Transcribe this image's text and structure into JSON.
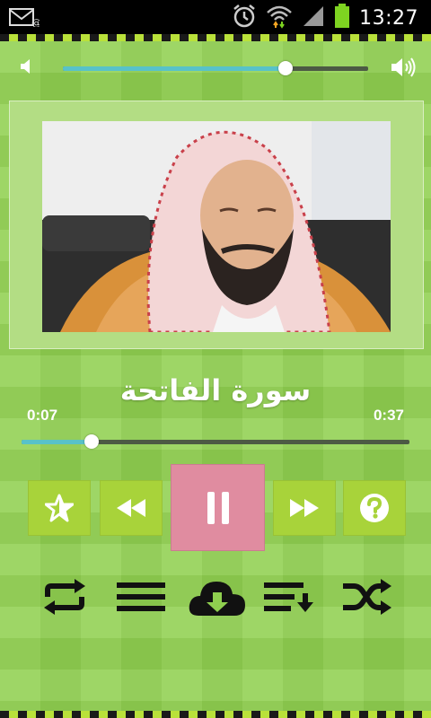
{
  "status_bar": {
    "time": "13:27",
    "icons": [
      "email-icon",
      "alarm-icon",
      "wifi-icon",
      "signal-icon",
      "battery-icon"
    ]
  },
  "player": {
    "volume_level": 0.73,
    "photo_description_icon": "reciter-photo",
    "surah_title": "سورة الفاتحة",
    "current_time": "0:07",
    "total_time": "0:37",
    "progress": 0.18,
    "state": "playing"
  },
  "controls": {
    "favorite_icon": "star-icon",
    "rewind_icon": "rewind-icon",
    "pause_icon": "pause-icon",
    "forward_icon": "fast-forward-icon",
    "help_icon": "question-icon"
  },
  "toolbar": {
    "icons": [
      "repeat-icon",
      "menu-icon",
      "cloud-download-icon",
      "playlist-icon",
      "shuffle-icon"
    ]
  },
  "colors": {
    "background": "#8fcf4f",
    "button": "#a8d33a",
    "play_button": "#e08ca0",
    "progress": "#58c2c9"
  }
}
